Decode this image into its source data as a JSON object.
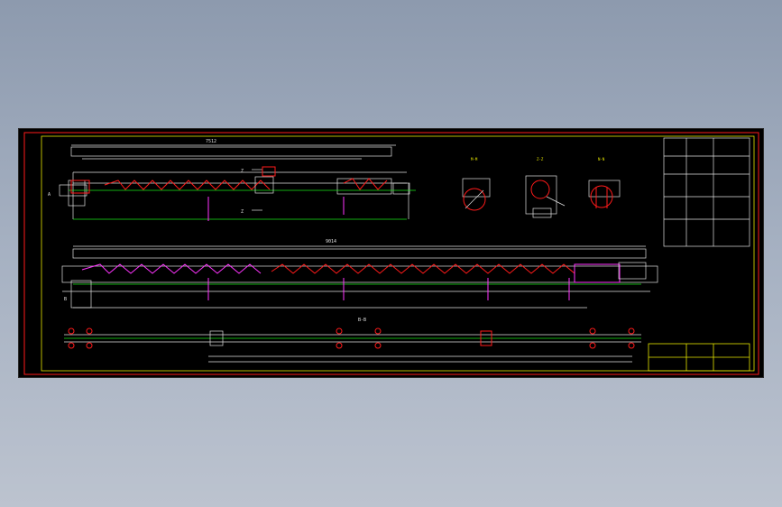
{
  "colors": {
    "background": "#000000",
    "frame": "#e6e600",
    "border": "#ff1a1a",
    "outline": "#e0e0e0",
    "flight": "#ff1a1a",
    "centerline": "#19e619",
    "highlight": "#ff33ff",
    "dimension": "#00d8ff"
  },
  "views": {
    "top_label": "7512",
    "main_label": "9014",
    "plan_label": "B-B",
    "section_1": "M-M",
    "section_2": "Z-Z",
    "section_3": "N-N",
    "cut_z_top": "Z",
    "cut_z_bottom": "Z",
    "cut_a": "A",
    "cut_b": "B"
  }
}
